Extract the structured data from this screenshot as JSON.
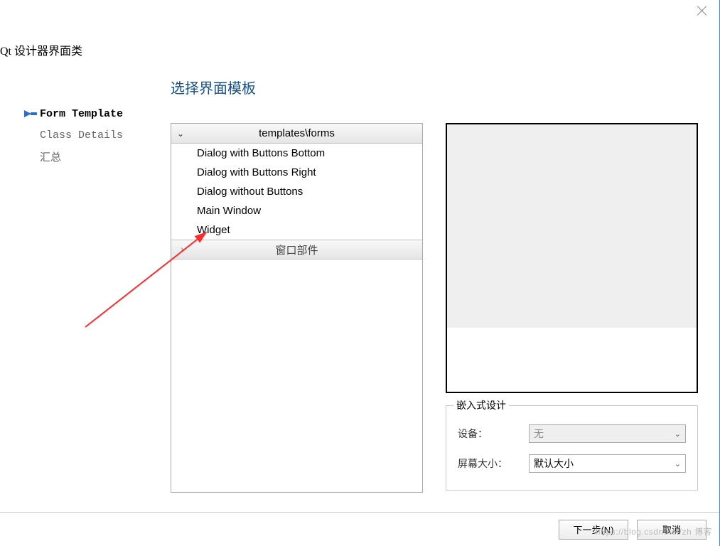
{
  "dialog_title": "Qt 设计器界面类",
  "sidebar": {
    "items": [
      {
        "label": "Form Template",
        "active": true
      },
      {
        "label": "Class Details",
        "active": false
      },
      {
        "label": "汇总",
        "active": false
      }
    ]
  },
  "section_title": "选择界面模板",
  "tree": {
    "group1": {
      "label": "templates\\forms",
      "expanded": true
    },
    "items": [
      "Dialog with Buttons Bottom",
      "Dialog with Buttons Right",
      "Dialog without Buttons",
      "Main Window",
      "Widget"
    ],
    "group2": {
      "label": "窗口部件",
      "expanded": false
    }
  },
  "embed": {
    "group_title": "嵌入式设计",
    "device_label": "设备：",
    "device_value": "无",
    "screen_label": "屏幕大小：",
    "screen_value": "默认大小"
  },
  "buttons": {
    "next": "下一步(N)",
    "cancel": "取消"
  },
  "watermark": "https://blog.csdn.net/zh 博客"
}
